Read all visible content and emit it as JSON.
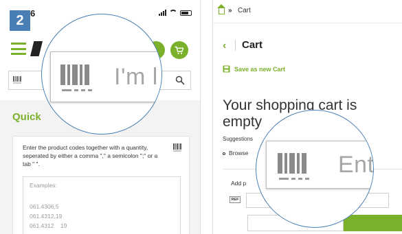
{
  "step_number": "2",
  "left_phone": {
    "status_time": "6",
    "lens_text": "I'm l",
    "quick_order": {
      "title": "Quick",
      "instructions": "Enter the product codes together with a quantity, seperated by either a comma \",\" a semicolon \";\" or a tab \" \".",
      "examples_title": "Examples:",
      "examples": [
        "061.4306,5",
        "061.4312,19",
        "061.4312    19"
      ]
    }
  },
  "right_phone": {
    "breadcrumb": {
      "separator": "»",
      "current": "Cart"
    },
    "title": "Cart",
    "save_label": "Save as new Cart",
    "empty_title": "Your shopping cart is empty",
    "suggestions_label": "Suggestions",
    "browse_text": "Browse",
    "browse_tail": "e",
    "add_label": "Add p",
    "ref_label": "REF",
    "lens_text": "Ent"
  },
  "colors": {
    "accent_green": "#7ab02a",
    "badge_blue": "#4a7fb5"
  },
  "icons": [
    "hamburger-menu-icon",
    "logo-icon",
    "user-icon",
    "cart-icon",
    "barcode-icon",
    "search-icon",
    "home-icon",
    "chevron-left-icon",
    "save-icon"
  ]
}
